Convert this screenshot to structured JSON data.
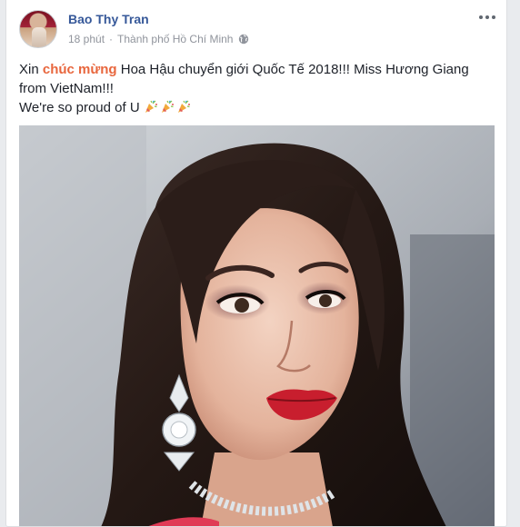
{
  "post": {
    "author": "Bao Thy Tran",
    "time": "18 phút",
    "separator": "·",
    "location": "Thành phố Hồ Chí Minh",
    "privacy_icon": "globe-icon",
    "menu_icon": "more-options-icon",
    "text": {
      "line1_prefix": "Xin ",
      "line1_highlight": "chúc mừng",
      "line1_suffix": " Hoa Hậu chuyển giới Quốc Tế 2018!!! Miss Hương Giang",
      "line2": "from VietNam!!!",
      "line3": "We're so proud of U ",
      "emojis": [
        "party-popper-icon",
        "party-popper-icon",
        "party-popper-icon"
      ]
    },
    "highlight_color": "#e8663d",
    "author_color": "#365899"
  }
}
